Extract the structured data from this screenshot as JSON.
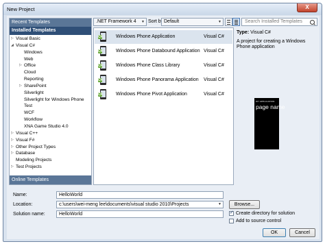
{
  "window": {
    "title": "New Project",
    "close_label": "X"
  },
  "left_panel": {
    "recent_label": "Recent Templates",
    "installed_label": "Installed Templates",
    "online_label": "Online Templates",
    "tree": [
      {
        "label": "Visual Basic",
        "level": 0,
        "arrow": "right"
      },
      {
        "label": "Visual C#",
        "level": 0,
        "arrow": "down"
      },
      {
        "label": "Windows",
        "level": 1
      },
      {
        "label": "Web",
        "level": 1
      },
      {
        "label": "Office",
        "level": 1,
        "arrow": "right"
      },
      {
        "label": "Cloud",
        "level": 1
      },
      {
        "label": "Reporting",
        "level": 1
      },
      {
        "label": "SharePoint",
        "level": 1,
        "arrow": "right"
      },
      {
        "label": "Silverlight",
        "level": 1
      },
      {
        "label": "Silverlight for Windows Phone",
        "level": 1
      },
      {
        "label": "Test",
        "level": 1
      },
      {
        "label": "WCF",
        "level": 1
      },
      {
        "label": "Workflow",
        "level": 1
      },
      {
        "label": "XNA Game Studio 4.0",
        "level": 1
      },
      {
        "label": "Visual C++",
        "level": 0,
        "arrow": "right"
      },
      {
        "label": "Visual F#",
        "level": 0,
        "arrow": "right"
      },
      {
        "label": "Other Project Types",
        "level": 0,
        "arrow": "right"
      },
      {
        "label": "Database",
        "level": 0,
        "arrow": "right"
      },
      {
        "label": "Modeling Projects",
        "level": 0
      },
      {
        "label": "Test Projects",
        "level": 0,
        "arrow": "right"
      }
    ]
  },
  "toolbar": {
    "framework": ".NET Framework 4",
    "sort_label": "Sort by:",
    "sort_value": "Default",
    "search_placeholder": "Search Installed Templates"
  },
  "templates": [
    {
      "name": "Windows Phone Application",
      "lang": "Visual C#",
      "selected": true
    },
    {
      "name": "Windows Phone Databound Application",
      "lang": "Visual C#"
    },
    {
      "name": "Windows Phone Class Library",
      "lang": "Visual C#"
    },
    {
      "name": "Windows Phone Panorama Application",
      "lang": "Visual C#"
    },
    {
      "name": "Windows Phone Pivot Application",
      "lang": "Visual C#"
    }
  ],
  "details": {
    "type_label": "Type:",
    "type_value": "Visual C#",
    "description": "A project for creating a Windows Phone application",
    "preview_app_title": "MY APPLICATION",
    "preview_page_name": "page name"
  },
  "form": {
    "name_label": "Name:",
    "name_value": "HelloWorld",
    "location_label": "Location:",
    "location_value": "c:\\users\\wei-meng lee\\documents\\visual studio 2010\\Projects",
    "solution_label": "Solution name:",
    "solution_value": "HelloWorld",
    "browse_label": "Browse...",
    "create_dir_label": "Create directory for solution",
    "create_dir_checked": true,
    "source_control_label": "Add to source control",
    "source_control_checked": false,
    "ok_label": "OK",
    "cancel_label": "Cancel"
  }
}
